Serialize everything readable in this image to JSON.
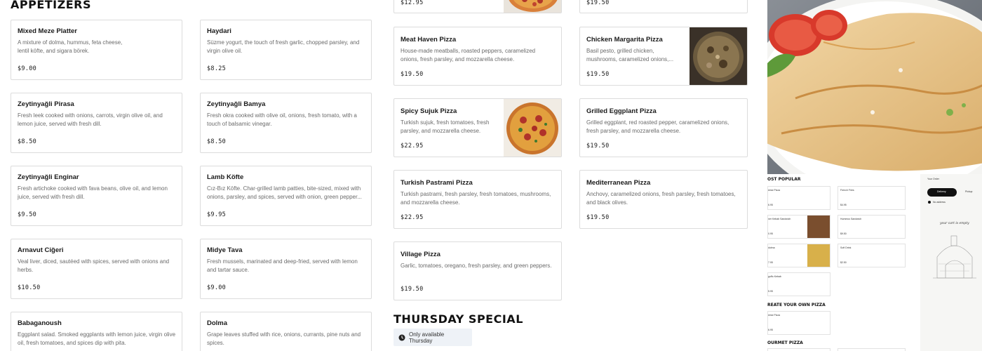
{
  "appetizers": {
    "title": "APPETIZERS",
    "items": [
      {
        "name": "Mixed Meze Platter",
        "desc": "A mixture of dolma, hummus, feta cheese, lentil köfte, and sigara börek.",
        "price": "$9.00"
      },
      {
        "name": "Haydari",
        "desc": "Süzme yogurt, the touch of fresh garlic, chopped parsley, and virgin olive oil.",
        "price": "$8.25"
      },
      {
        "name": "Zeytinyağli Pirasa",
        "desc": "Fresh leek cooked with onions, carrots, virgin olive oil, and lemon juice, served with fresh dill.",
        "price": "$8.50"
      },
      {
        "name": "Zeytinyağli Bamya",
        "desc": "Fresh okra cooked with olive oil, onions, fresh tomato, with a touch of balsamic vinegar.",
        "price": "$8.50"
      },
      {
        "name": "Zeytinyağli Enginar",
        "desc": "Fresh artichoke cooked with fava beans, olive oil, and lemon juice, served with fresh dill.",
        "price": "$9.50"
      },
      {
        "name": "Lamb Köfte",
        "desc": "Cız-Bız Köfte. Char-grilled lamb patties, bite-sized, mixed with onions, parsley, and spices, served with onion, green pepper...",
        "price": "$9.95"
      },
      {
        "name": "Arnavut Ciğeri",
        "desc": "Veal liver, diced, sautéed with spices, served with onions and herbs.",
        "price": "$10.50"
      },
      {
        "name": "Midye Tava",
        "desc": "Fresh mussels, marinated and deep-fried, served with lemon and tartar sauce.",
        "price": "$9.00"
      },
      {
        "name": "Babaganoush",
        "desc": "Eggplant salad. Smoked eggplants with lemon juice, virgin olive oil, fresh tomatoes, and spices dip with pita.",
        "price": ""
      },
      {
        "name": "Dolma",
        "desc": "Grape leaves stuffed with rice, onions, currants, pine nuts and spices.",
        "price": ""
      }
    ]
  },
  "pizzas": {
    "top_prices": [
      "$12.95",
      "$19.50"
    ],
    "items": [
      {
        "name": "Meat Haven Pizza",
        "desc": "House-made meatballs, roasted peppers, caramelized onions, fresh parsley, and mozzarella cheese.",
        "price": "$19.50",
        "thumb": ""
      },
      {
        "name": "Chicken Margarita Pizza",
        "desc": "Basil pesto, grilled chicken, mushrooms, caramelized onions,...",
        "price": "$19.50",
        "thumb": "chicken-pizza-photo"
      },
      {
        "name": "Spicy Sujuk Pizza",
        "desc": "Turkish sujuk, fresh tomatoes, fresh parsley, and mozzarella cheese.",
        "price": "$22.95",
        "thumb": "sujuk-pizza-photo"
      },
      {
        "name": "Grilled Eggplant Pizza",
        "desc": "Grilled eggplant, red roasted pepper, caramelized onions, fresh parsley, and mozzarella cheese.",
        "price": "$19.50",
        "thumb": ""
      },
      {
        "name": "Turkish Pastrami Pizza",
        "desc": "Turkish pastrami, fresh parsley, fresh tomatoes, mushrooms, and mozzarella cheese.",
        "price": "$22.95",
        "thumb": ""
      },
      {
        "name": "Mediterranean Pizza",
        "desc": "Anchovy, caramelized onions, fresh parsley, fresh tomatoes, and black olives.",
        "price": "$19.50",
        "thumb": ""
      },
      {
        "name": "Village Pizza",
        "desc": "Garlic, tomatoes, oregano, fresh parsley, and green peppers.",
        "price": "$19.50",
        "thumb": ""
      }
    ]
  },
  "thursday": {
    "title": "THURSDAY SPECIAL",
    "badge": "Only available Thursday",
    "badge_icon": "clock-icon"
  },
  "mini_preview": {
    "most_popular": "OST POPULAR",
    "create_own": "REATE YOUR OWN PIZZA",
    "gourmet": "OURMET PIZZA",
    "your_order": "Your Order",
    "delivery": "Delivery",
    "pickup": "Pickup",
    "no_address": "No address",
    "cart_empty": "your cart is empty",
    "items": [
      "eese Pizza",
      "French Fries",
      "ner Kebab Sandwich",
      "Hummus Sandwich",
      "dolma",
      "Soft Drink",
      "guffo Kebab",
      "eese Pizza"
    ],
    "prices": [
      "6.95",
      "$4.95",
      "0.95",
      "$9.50",
      "7.95",
      "$2.50",
      "5.95",
      "6.95"
    ]
  },
  "colors": {
    "accent": "#111111",
    "border": "#dcdcdc",
    "badge_bg": "#eef2f7"
  }
}
